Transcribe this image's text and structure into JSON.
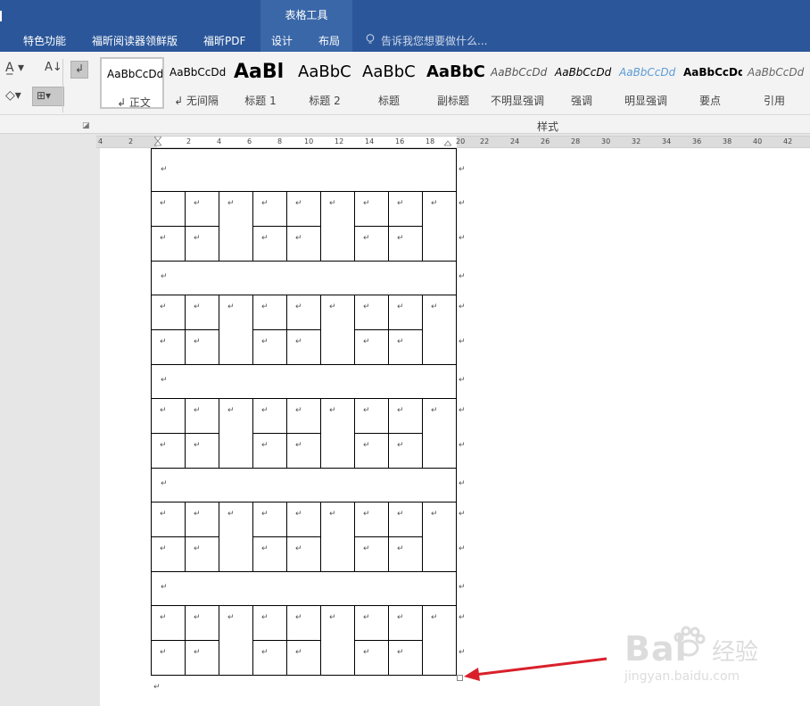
{
  "tabs": {
    "features": "特色功能",
    "foxit_reader": "福昕阅读器领鲜版",
    "foxit_pdf": "福昕PDF",
    "design": "设计",
    "layout": "布局",
    "table_tools": "表格工具",
    "tell_me": "告诉我您想要做什么..."
  },
  "styles": [
    {
      "sample": "AaBbCcDd",
      "name": "↲ 正文"
    },
    {
      "sample": "AaBbCcDd",
      "name": "↲ 无间隔"
    },
    {
      "sample": "AaBl",
      "name": "标题 1"
    },
    {
      "sample": "AaBbC",
      "name": "标题 2"
    },
    {
      "sample": "AaBbC",
      "name": "标题"
    },
    {
      "sample": "AaBbC",
      "name": "副标题"
    },
    {
      "sample": "AaBbCcDd",
      "name": "不明显强调"
    },
    {
      "sample": "AaBbCcDd",
      "name": "强调"
    },
    {
      "sample": "AaBbCcDd",
      "name": "明显强调"
    },
    {
      "sample": "AaBbCcDd",
      "name": "要点"
    },
    {
      "sample": "AaBbCcDd",
      "name": "引用"
    }
  ],
  "styles_group_label": "样式",
  "ruler_numbers": [
    "4",
    "2",
    "2",
    "4",
    "6",
    "8",
    "10",
    "12",
    "14",
    "16",
    "18",
    "20",
    "22",
    "24",
    "26",
    "28",
    "30",
    "32",
    "34",
    "36",
    "38",
    "40",
    "42"
  ],
  "paragraph_mark": "↵",
  "watermark": {
    "brand": "Bai",
    "brand_cn": "经验",
    "url": "jingyan.baidu.com"
  },
  "colors": {
    "title_bar": "#2b579a",
    "contextual_tab": "#3a67a8",
    "annotation_arrow": "#d9202a"
  },
  "icons": [
    "text-effects-icon",
    "sort-icon",
    "show-paragraph-marks-icon",
    "shading-icon",
    "borders-icon",
    "lightbulb-icon",
    "table-move-handle-icon",
    "table-resize-handle-icon",
    "arrow-icon"
  ]
}
